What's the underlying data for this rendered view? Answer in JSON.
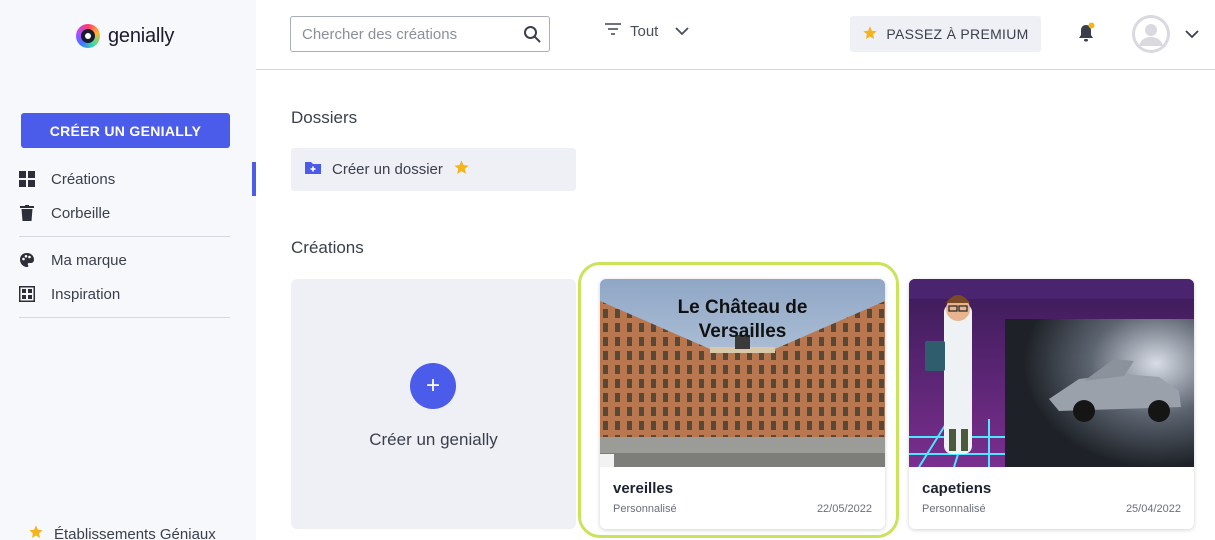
{
  "brand": {
    "name": "genially"
  },
  "sidebar": {
    "create_label": "CRÉER UN GENIALLY",
    "items": [
      {
        "label": "Créations",
        "icon": "grid-icon",
        "active": true
      },
      {
        "label": "Corbeille",
        "icon": "trash-icon"
      },
      {
        "label": "Ma marque",
        "icon": "palette-icon"
      },
      {
        "label": "Inspiration",
        "icon": "inspiration-icon"
      }
    ],
    "footer": {
      "label": "Établissements Géniaux",
      "icon": "star-icon"
    }
  },
  "header": {
    "search": {
      "placeholder": "Chercher des créations",
      "value": ""
    },
    "filter": {
      "label": "Tout"
    },
    "premium_label": "PASSEZ À PREMIUM",
    "notification_dot_color": "#f5b31c"
  },
  "main": {
    "folders_title": "Dossiers",
    "create_folder_label": "Créer un dossier",
    "creations_title": "Créations",
    "new_creation_label": "Créer un genially",
    "new_creation_icon": "+",
    "cards": [
      {
        "title": "vereilles",
        "type": "Personnalisé",
        "date": "22/05/2022",
        "thumb_title": "Le Château de Versailles",
        "highlighted": true
      },
      {
        "title": "capetiens",
        "type": "Personnalisé",
        "date": "25/04/2022",
        "thumb_title": ""
      }
    ]
  },
  "colors": {
    "accent": "#4b5bea",
    "highlight": "#c9e35a",
    "star": "#f5b31c"
  }
}
